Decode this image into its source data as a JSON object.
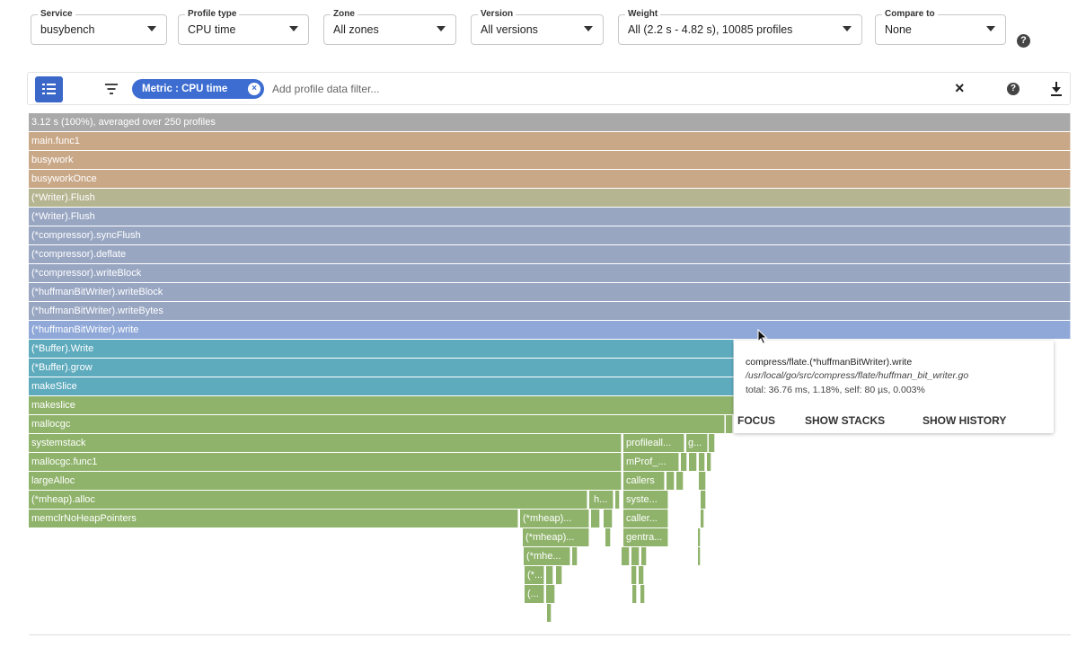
{
  "selectors": [
    {
      "label": "Service",
      "value": "busybench"
    },
    {
      "label": "Profile type",
      "value": "CPU time"
    },
    {
      "label": "Zone",
      "value": "All zones"
    },
    {
      "label": "Version",
      "value": "All versions"
    },
    {
      "label": "Weight",
      "value": "All (2.2 s - 4.82 s), 10085 profiles"
    },
    {
      "label": "Compare to",
      "value": "None"
    }
  ],
  "filter": {
    "chip_label": "Metric : CPU time",
    "placeholder": "Add profile data filter..."
  },
  "icons": {
    "help": "?",
    "close": "×",
    "chip_remove": "×"
  },
  "colors": {
    "root": "#a9a9a9",
    "tan": "#c9a888",
    "olive_tan": "#b6b591",
    "slate": "#98a6c2",
    "highlight": "#8fa8d8",
    "teal": "#5fabbe",
    "green": "#8fb36b",
    "accent": "#3d6dd1"
  },
  "flame": {
    "root_label": "3.12 s (100%), averaged over 250 profiles",
    "stack": [
      "main.func1",
      "busywork",
      "busyworkOnce",
      "(*Writer).Flush",
      "(*Writer).Flush",
      "(*compressor).syncFlush",
      "(*compressor).deflate",
      "(*compressor).writeBlock",
      "(*huffmanBitWriter).writeBlock",
      "(*huffmanBitWriter).writeBytes",
      "(*huffmanBitWriter).write",
      "(*Buffer).Write",
      "(*Buffer).grow",
      "makeSlice",
      "makeslice",
      "mallocgc",
      "systemstack",
      "mallocgc.func1",
      "largeAlloc",
      "(*mheap).alloc",
      "memclrNoHeapPointers"
    ],
    "small_frames": [
      "profileall...",
      "g...",
      "mProf_...",
      "callers",
      "h...",
      "syste...",
      "(*mheap)...",
      "caller...",
      "(*mheap)...",
      "gentra...",
      "(*mhe...",
      "(*...",
      "(..."
    ]
  },
  "tooltip": {
    "function": "compress/flate.(*huffmanBitWriter).write",
    "file": "/usr/local/go/src/compress/flate/huffman_bit_writer.go",
    "stats": "total: 36.76 ms, 1.18%, self: 80 µs, 0.003%",
    "actions": [
      "FOCUS",
      "SHOW STACKS",
      "SHOW HISTORY"
    ]
  }
}
